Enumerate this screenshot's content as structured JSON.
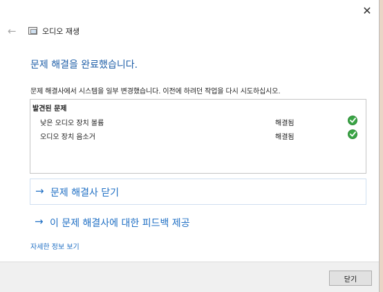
{
  "window": {
    "close_glyph": "✕"
  },
  "nav": {
    "back_glyph": "←",
    "title": "오디오 재생"
  },
  "main": {
    "heading": "문제 해결을 완료했습니다.",
    "description": "문제 해결사에서 시스템을 일부 변경했습니다. 이전에 하려던 작업을 다시 시도하십시오."
  },
  "problems": {
    "header": "발견된 문제",
    "items": [
      {
        "name": "낮은 오디오 장치 볼륨",
        "status": "해결됨"
      },
      {
        "name": "오디오 장치 음소거",
        "status": "해결됨"
      }
    ],
    "status_color": "#3aa545"
  },
  "actions": {
    "arrow_glyph": "→",
    "close_troubleshooter": "문제 해결사 닫기",
    "feedback": "이 문제 해결사에 대한 피드백 제공",
    "details": "자세한 정보 보기"
  },
  "footer": {
    "close_label": "닫기"
  },
  "icons": {
    "back": "back-arrow-icon",
    "app": "troubleshooter-icon",
    "check": "check-circle-icon",
    "link": "arrow-right-icon"
  },
  "colors": {
    "heading": "#1f5fa8",
    "link": "#1f6fc4",
    "desktop": "#e9d6c6"
  }
}
